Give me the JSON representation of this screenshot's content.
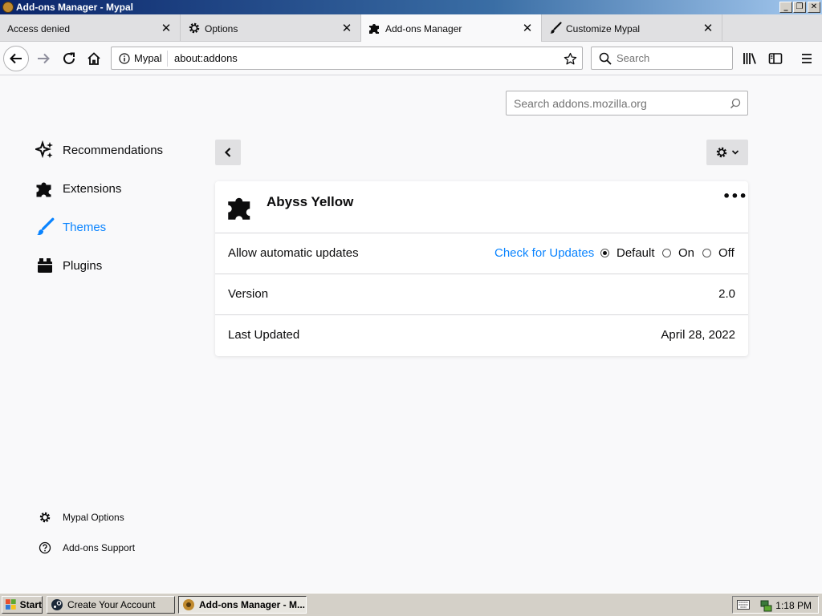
{
  "window": {
    "title": "Add-ons Manager - Mypal",
    "controls": [
      "_",
      "❐",
      "✕"
    ]
  },
  "tabs": [
    {
      "label": "Access denied",
      "icon": "none",
      "active": false
    },
    {
      "label": "Options",
      "icon": "gear-icon",
      "active": false
    },
    {
      "label": "Add-ons Manager",
      "icon": "puzzle-icon",
      "active": true
    },
    {
      "label": "Customize Mypal",
      "icon": "paintbrush-icon",
      "active": false
    }
  ],
  "navbar": {
    "identity_label": "Mypal",
    "url": "about:addons",
    "search_placeholder": "Search"
  },
  "addons": {
    "amo_search_placeholder": "Search addons.mozilla.org",
    "categories": [
      {
        "label": "Recommendations",
        "icon": "sparkles-icon",
        "selected": false
      },
      {
        "label": "Extensions",
        "icon": "puzzle-icon",
        "selected": false
      },
      {
        "label": "Themes",
        "icon": "paintbrush-icon",
        "selected": true
      },
      {
        "label": "Plugins",
        "icon": "plugin-icon",
        "selected": false
      }
    ],
    "footer": {
      "options_label": "Mypal Options",
      "support_label": "Add-ons Support"
    },
    "accent_color": "#0a84ff",
    "detail": {
      "name": "Abyss Yellow",
      "more_label": "•••",
      "updates_label": "Allow automatic updates",
      "check_updates_label": "Check for Updates",
      "update_options": [
        "Default",
        "On",
        "Off"
      ],
      "update_selected": "Default",
      "version_label": "Version",
      "version_value": "2.0",
      "last_updated_label": "Last Updated",
      "last_updated_value": "April 28, 2022"
    }
  },
  "taskbar": {
    "start_label": "Start",
    "tasks": [
      {
        "label": "Create Your Account",
        "active": false
      },
      {
        "label": "Add-ons Manager - M...",
        "active": true
      }
    ],
    "clock": "1:18 PM"
  }
}
